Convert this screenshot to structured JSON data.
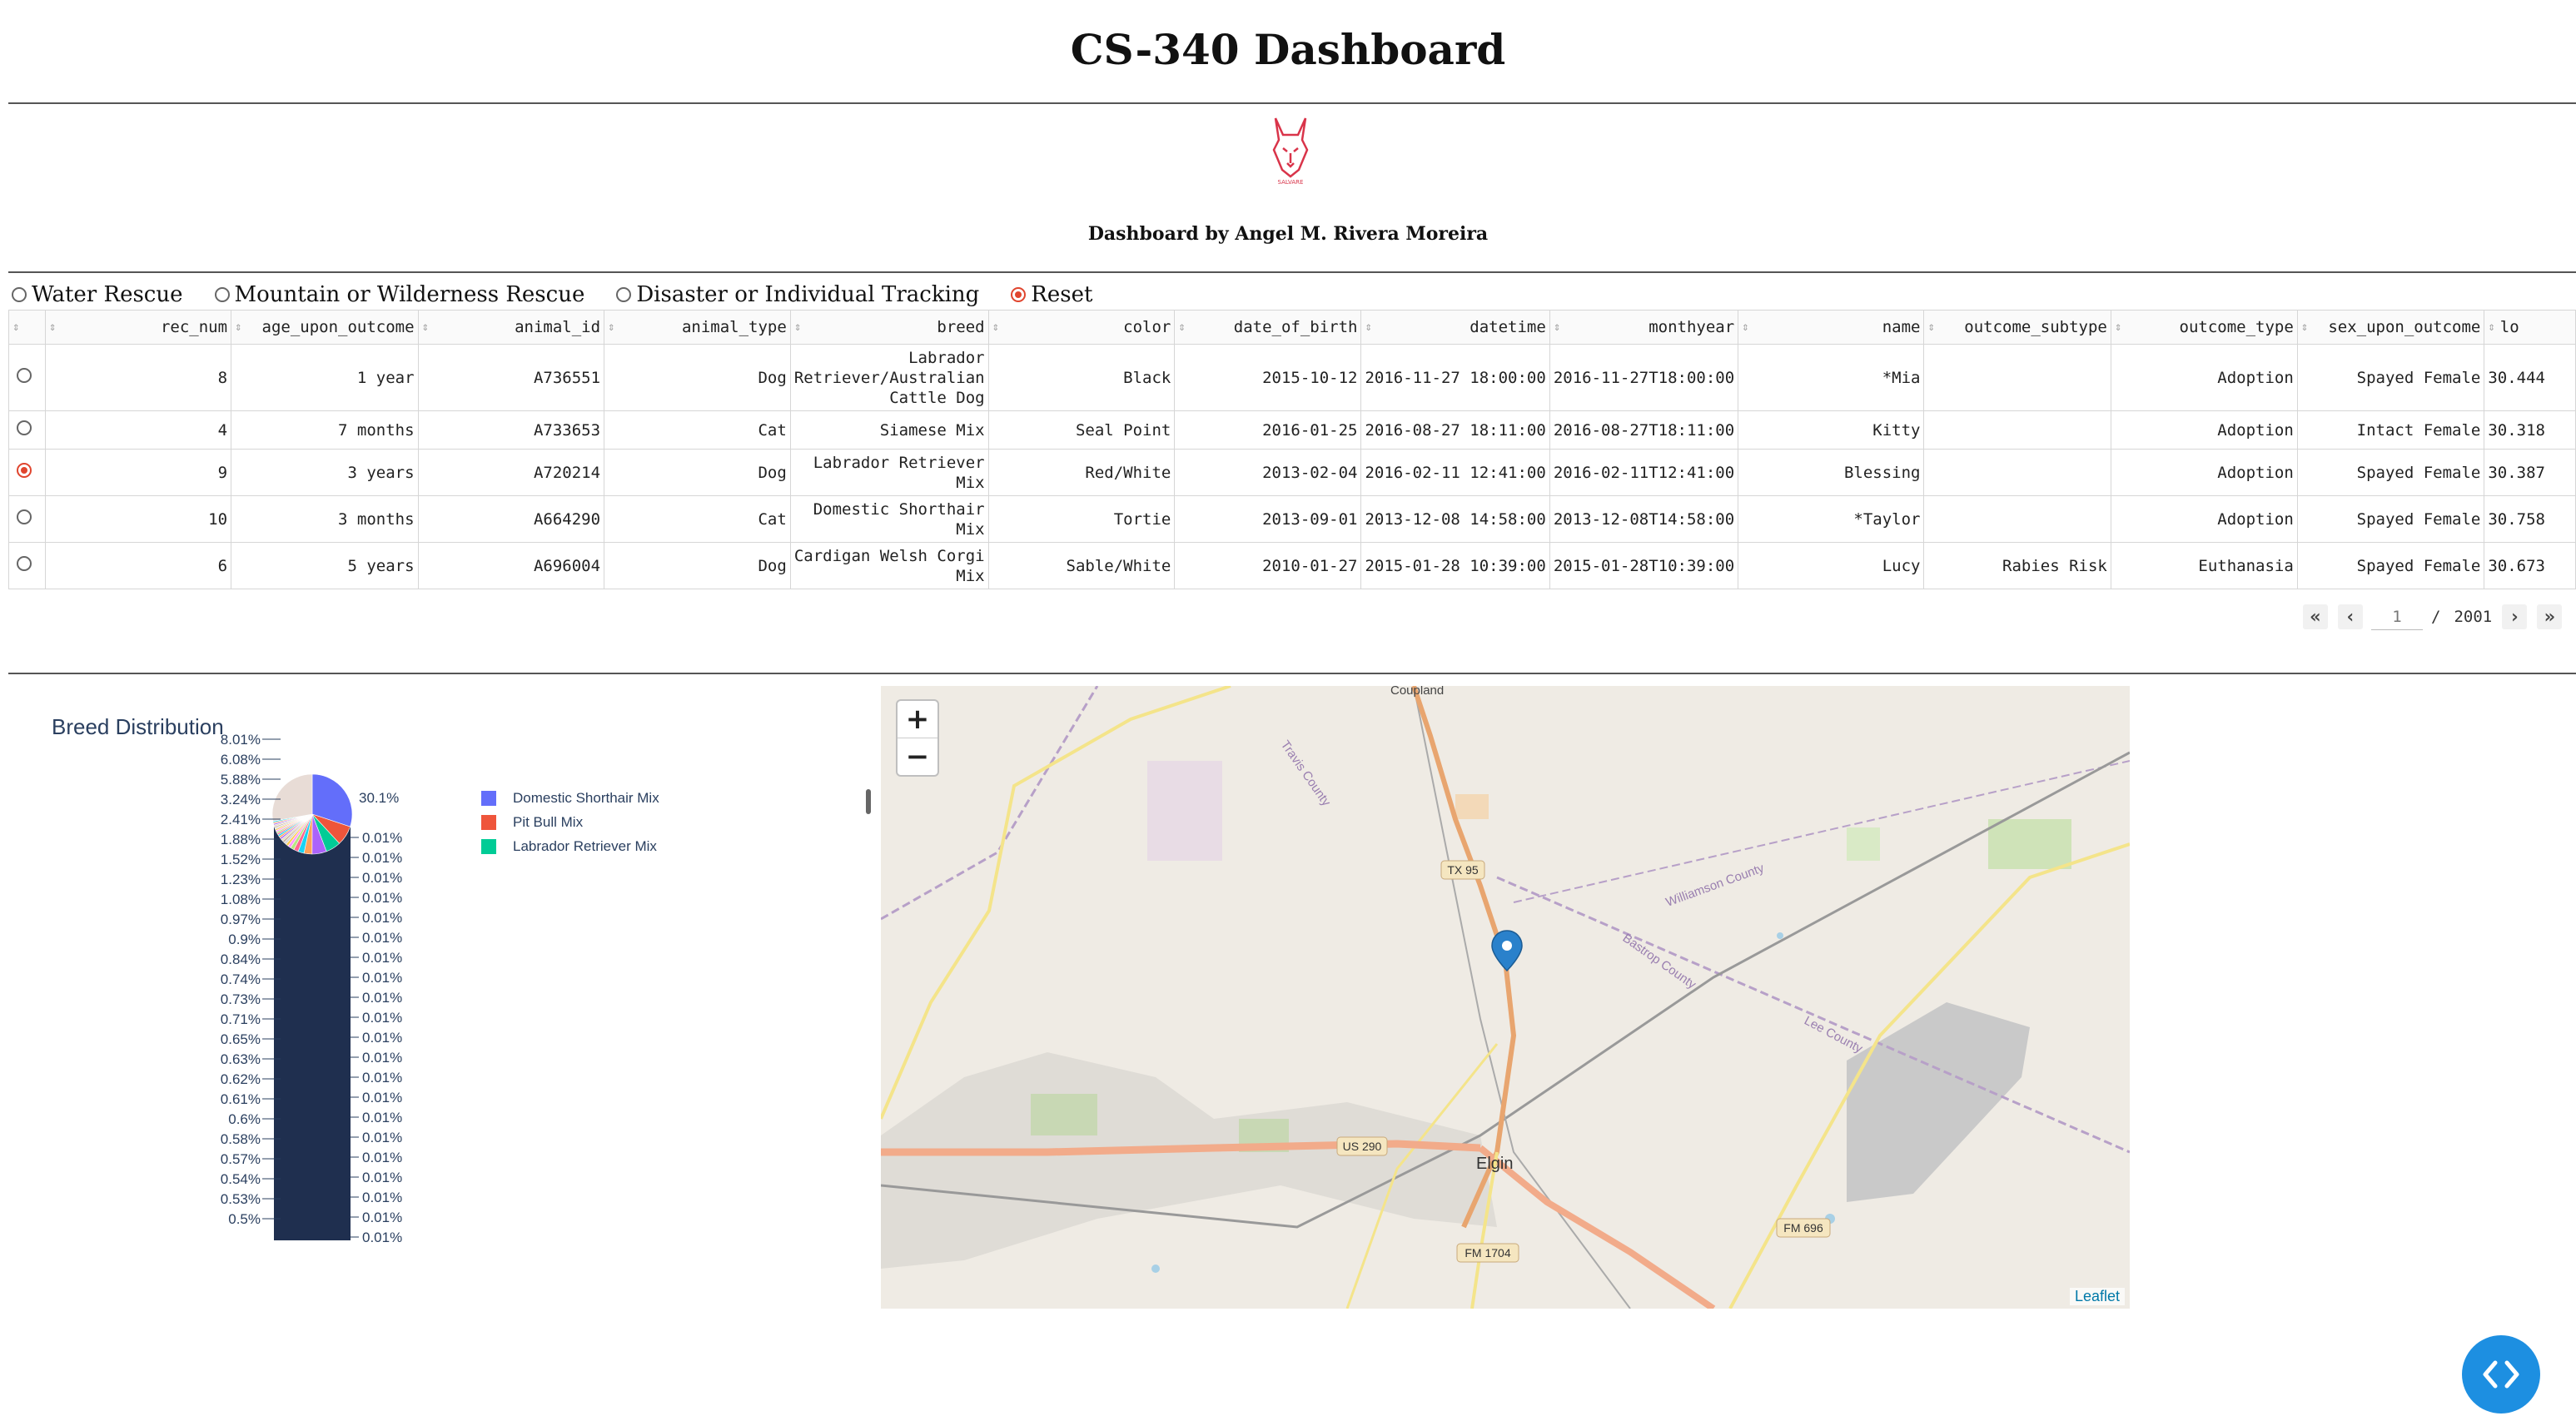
{
  "header": {
    "title": "CS-340 Dashboard",
    "logo_text": "SALVARE",
    "byline": "Dashboard by Angel M. Rivera Moreira"
  },
  "filters": {
    "options": [
      {
        "label": "Water Rescue",
        "selected": false
      },
      {
        "label": "Mountain or Wilderness Rescue",
        "selected": false
      },
      {
        "label": "Disaster or Individual Tracking",
        "selected": false
      },
      {
        "label": "Reset",
        "selected": true
      }
    ]
  },
  "table": {
    "columns": [
      "rec_num",
      "age_upon_outcome",
      "animal_id",
      "animal_type",
      "breed",
      "color",
      "date_of_birth",
      "datetime",
      "monthyear",
      "name",
      "outcome_subtype",
      "outcome_type",
      "sex_upon_outcome",
      "lo"
    ],
    "rows": [
      {
        "selected": false,
        "cells": [
          "8",
          "1 year",
          "A736551",
          "Dog",
          "Labrador Retriever/Australian Cattle Dog",
          "Black",
          "2015-10-12",
          "2016-11-27 18:00:00",
          "2016-11-27T18:00:00",
          "*Mia",
          "",
          "Adoption",
          "Spayed Female",
          "30.444"
        ]
      },
      {
        "selected": false,
        "cells": [
          "4",
          "7 months",
          "A733653",
          "Cat",
          "Siamese Mix",
          "Seal Point",
          "2016-01-25",
          "2016-08-27 18:11:00",
          "2016-08-27T18:11:00",
          "Kitty",
          "",
          "Adoption",
          "Intact Female",
          "30.318"
        ]
      },
      {
        "selected": true,
        "cells": [
          "9",
          "3 years",
          "A720214",
          "Dog",
          "Labrador Retriever Mix",
          "Red/White",
          "2013-02-04",
          "2016-02-11 12:41:00",
          "2016-02-11T12:41:00",
          "Blessing",
          "",
          "Adoption",
          "Spayed Female",
          "30.387"
        ]
      },
      {
        "selected": false,
        "cells": [
          "10",
          "3 months",
          "A664290",
          "Cat",
          "Domestic Shorthair Mix",
          "Tortie",
          "2013-09-01",
          "2013-12-08 14:58:00",
          "2013-12-08T14:58:00",
          "*Taylor",
          "",
          "Adoption",
          "Spayed Female",
          "30.758"
        ]
      },
      {
        "selected": false,
        "cells": [
          "6",
          "5 years",
          "A696004",
          "Dog",
          "Cardigan Welsh Corgi Mix",
          "Sable/White",
          "2010-01-27",
          "2015-01-28 10:39:00",
          "2015-01-28T10:39:00",
          "Lucy",
          "Rabies Risk",
          "Euthanasia",
          "Spayed Female",
          "30.673"
        ]
      }
    ],
    "pager": {
      "current": "1",
      "separator": "/",
      "total": "2001"
    }
  },
  "chart_data": {
    "type": "pie",
    "title": "Breed Distribution",
    "slices": [
      {
        "label": "Domestic Shorthair Mix",
        "percent": 30.1,
        "color": "#636efa"
      },
      {
        "label": "Pit Bull Mix",
        "percent": 8.01,
        "color": "#ef553b"
      },
      {
        "label": "Labrador Retriever Mix",
        "percent": 6.08,
        "color": "#00cc96"
      }
    ],
    "left_labels": [
      "8.01%",
      "6.08%",
      "5.88%",
      "3.24%",
      "2.41%",
      "1.88%",
      "1.52%",
      "1.23%",
      "1.08%",
      "0.97%",
      "0.9%",
      "0.84%",
      "0.74%",
      "0.73%",
      "0.71%",
      "0.65%",
      "0.63%",
      "0.62%",
      "0.61%",
      "0.6%",
      "0.58%",
      "0.57%",
      "0.54%",
      "0.53%",
      "0.5%"
    ],
    "right_top_label": "30.1%",
    "right_labels": [
      "0.01%",
      "0.01%",
      "0.01%",
      "0.01%",
      "0.01%",
      "0.01%",
      "0.01%",
      "0.01%",
      "0.01%",
      "0.01%",
      "0.01%",
      "0.01%",
      "0.01%",
      "0.01%",
      "0.01%",
      "0.01%",
      "0.01%",
      "0.01%",
      "0.01%",
      "0.01%",
      "0.01%"
    ],
    "legend": [
      "Domestic Shorthair Mix",
      "Pit Bull Mix",
      "Labrador Retriever Mix"
    ],
    "legend_placement": "right",
    "colors": {
      "tail": "#1f2f4f"
    }
  },
  "map": {
    "zoom_in": "+",
    "zoom_out": "−",
    "attribution": "Leaflet",
    "labels": {
      "coupland": "Coupland",
      "travis": "Travis County",
      "williamson": "Williamson County",
      "bastrop": "Bastrop County",
      "lee": "Lee County",
      "elgin": "Elgin",
      "tx95": "TX 95",
      "us290": "US 290",
      "fm1704": "FM 1704",
      "fm696": "FM 696"
    },
    "marker_color": "#2a81cb"
  },
  "fab": {
    "icon": "code-icon"
  }
}
